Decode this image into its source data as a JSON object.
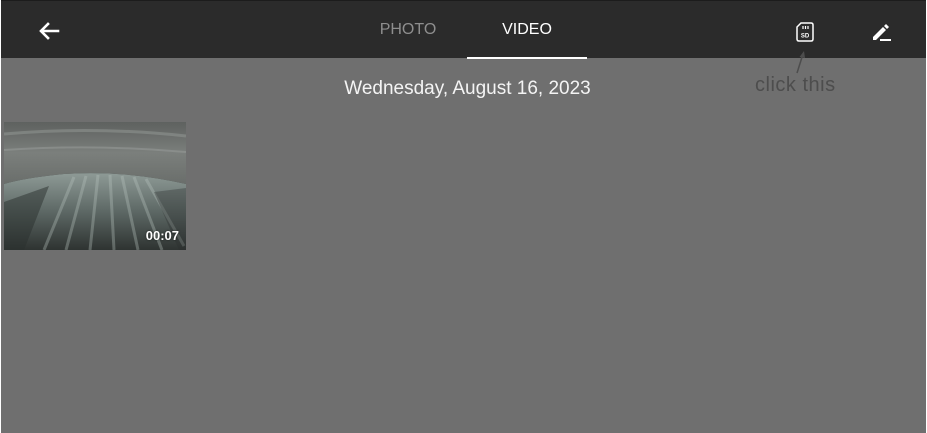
{
  "header": {
    "back_icon": "arrow-left-icon",
    "tabs": [
      {
        "label": "PHOTO",
        "active": false
      },
      {
        "label": "VIDEO",
        "active": true
      }
    ],
    "sd_icon": "sd-card-icon",
    "edit_icon": "pencil-icon"
  },
  "annotation": {
    "text": "click this",
    "icon": "annotation-arrow-icon"
  },
  "gallery": {
    "date": "Wednesday, August 16, 2023",
    "items": [
      {
        "duration": "00:07"
      }
    ]
  },
  "colors": {
    "topbar": "#2b2b2b",
    "background": "#6f6f6f",
    "active_tab": "#ffffff",
    "inactive_tab": "#8e8e8e"
  }
}
